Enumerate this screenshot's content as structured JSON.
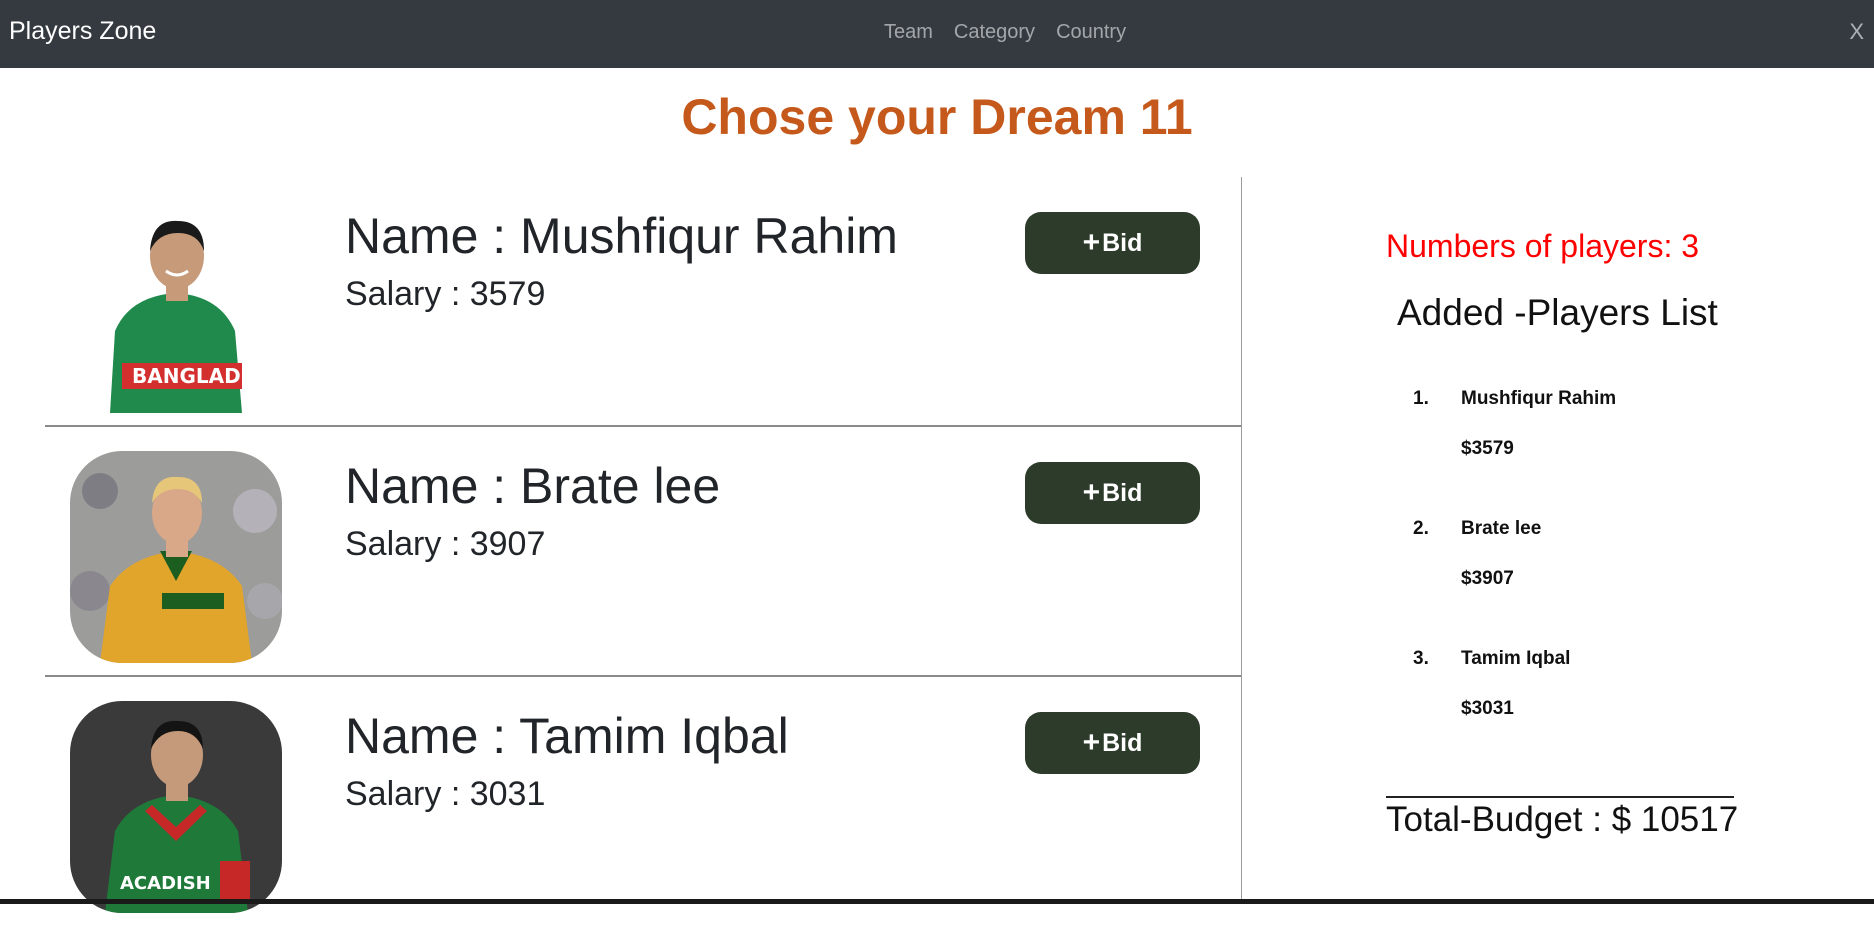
{
  "navbar": {
    "brand": "Players Zone",
    "links": [
      "Team",
      "Category",
      "Country"
    ],
    "close_label": "X"
  },
  "page_title": "Chose your Dream 11",
  "players": [
    {
      "name_text": "Name : Mushfiqur Rahim",
      "salary_text": "Salary : 3579",
      "bid_label": "Bid",
      "jersey_color": "#1f8a4c",
      "accent_color": "#d32f2f"
    },
    {
      "name_text": "Name : Brate lee",
      "salary_text": "Salary : 3907",
      "bid_label": "Bid",
      "jersey_color": "#e0a52a",
      "accent_color": "#1b5e20"
    },
    {
      "name_text": "Name : Tamim Iqbal",
      "salary_text": "Salary : 3031",
      "bid_label": "Bid",
      "jersey_color": "#1f7a3a",
      "accent_color": "#c62828"
    }
  ],
  "sidebar": {
    "count_text": "Numbers of players: 3",
    "list_title": "Added -Players List",
    "items": [
      {
        "num": "1.",
        "name": "Mushfiqur Rahim",
        "price": "$3579"
      },
      {
        "num": "2.",
        "name": "Brate lee",
        "price": "$3907"
      },
      {
        "num": "3.",
        "name": "Tamim Iqbal",
        "price": "$3031"
      }
    ],
    "budget_text": "Total-Budget : $ 10517"
  },
  "colors": {
    "navbar_bg": "#343a40",
    "title": "#c5591b",
    "bid_button": "#2d3b2b",
    "count_red": "#ff0000"
  }
}
